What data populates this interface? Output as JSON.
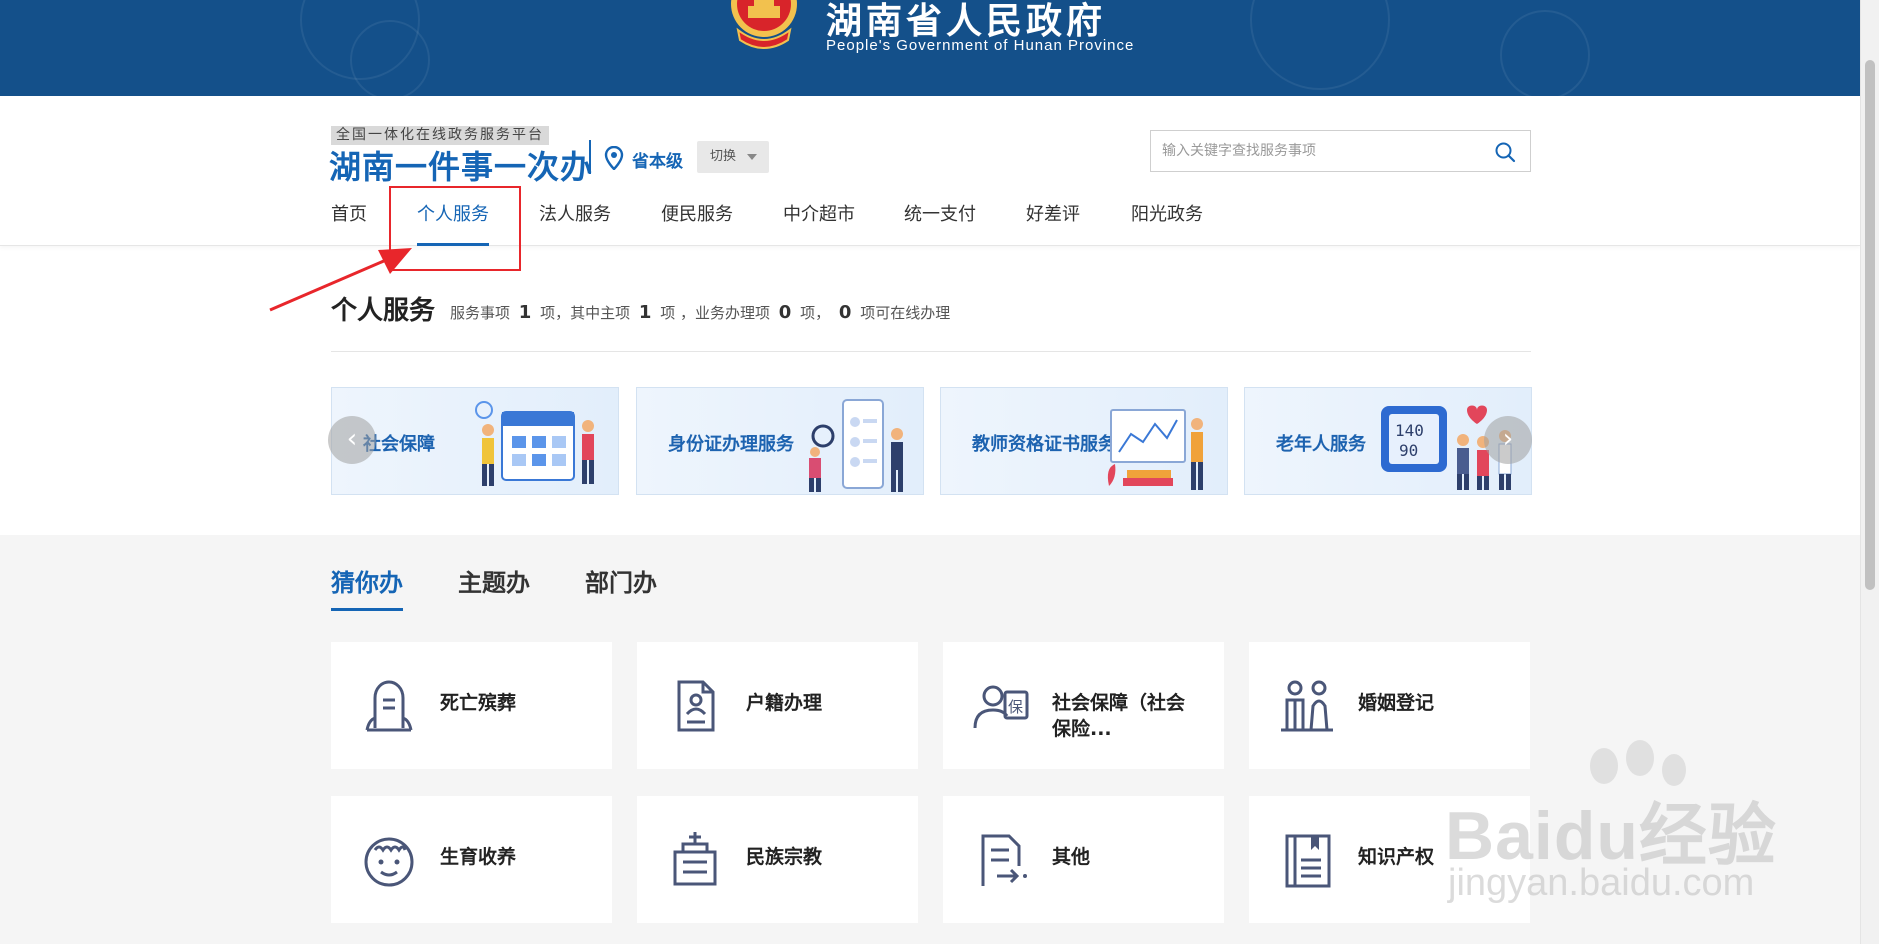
{
  "banner": {
    "title_cn": "湖南省人民政府",
    "title_en": "People's Government of Hunan Province",
    "background_color": "#14508a"
  },
  "platform": {
    "tag": "全国一体化在线政务服务平台",
    "name": "湖南一件事一次办",
    "location": "省本级",
    "switch_label": "切换",
    "brand_color": "#1565b5"
  },
  "search": {
    "placeholder": "输入关键字查找服务事项",
    "value": ""
  },
  "nav": {
    "items": [
      {
        "label": "首页"
      },
      {
        "label": "个人服务",
        "active": true
      },
      {
        "label": "法人服务"
      },
      {
        "label": "便民服务"
      },
      {
        "label": "中介超市"
      },
      {
        "label": "统一支付"
      },
      {
        "label": "好差评"
      },
      {
        "label": "阳光政务"
      }
    ]
  },
  "annotation": {
    "color": "#e8262b"
  },
  "section": {
    "title": "个人服务",
    "stats": {
      "prefix": "服务事项",
      "total": "1",
      "unit1": "项，其中主项",
      "main": "1",
      "unit2": "项 ，业务办理项",
      "business": "0",
      "unit3": "项，",
      "online": "0",
      "suffix": "项可在线办理"
    }
  },
  "carousel": {
    "cards": [
      {
        "label": "社会保障",
        "art": "calendar-people-icon"
      },
      {
        "label": "身份证办理服务",
        "art": "id-card-people-icon"
      },
      {
        "label": "教师资格证书服务",
        "art": "teacher-board-icon"
      },
      {
        "label": "老年人服务",
        "art": "elderly-bp-monitor-icon"
      }
    ],
    "prev_icon": "chevron-left-icon",
    "next_icon": "chevron-right-icon"
  },
  "filter_tabs": [
    {
      "label": "猜你办",
      "active": true
    },
    {
      "label": "主题办"
    },
    {
      "label": "部门办"
    }
  ],
  "services": [
    {
      "label": "死亡殡葬",
      "icon": "tombstone-icon"
    },
    {
      "label": "户籍办理",
      "icon": "household-register-icon"
    },
    {
      "label": "社会保障（社会保险...",
      "icon": "social-security-icon"
    },
    {
      "label": "婚姻登记",
      "icon": "wedding-couple-icon"
    },
    {
      "label": "生育收养",
      "icon": "baby-face-icon"
    },
    {
      "label": "民族宗教",
      "icon": "religion-building-icon"
    },
    {
      "label": "其他",
      "icon": "other-document-icon"
    },
    {
      "label": "知识产权",
      "icon": "intellectual-property-icon"
    }
  ],
  "watermark": {
    "text": "Baidu经验",
    "url": "jingyan.baidu.com"
  }
}
